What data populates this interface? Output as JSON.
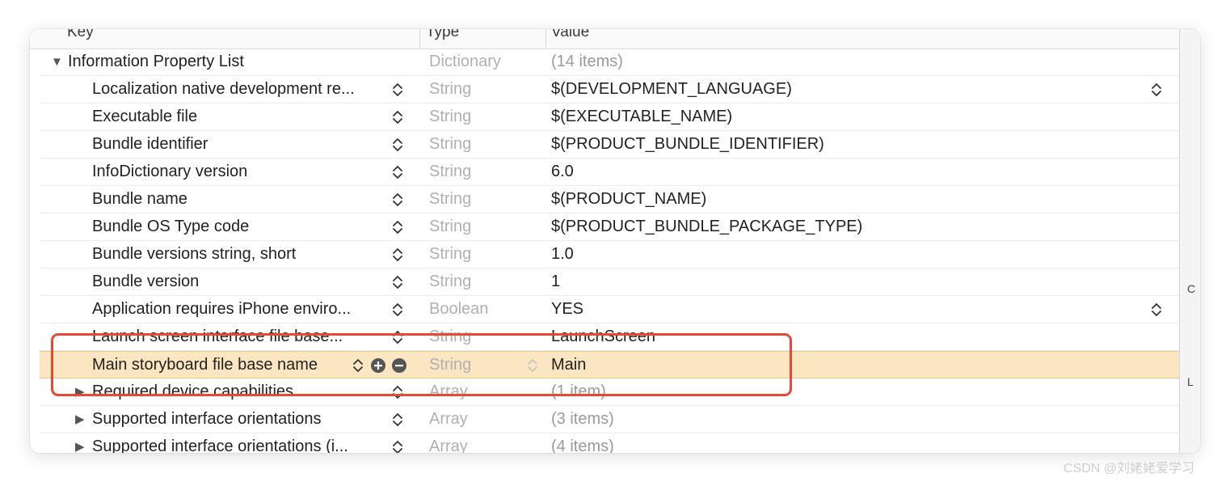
{
  "header": {
    "key": "Key",
    "type": "Type",
    "value": "Value"
  },
  "rows": [
    {
      "key": "Information Property List",
      "type": "Dictionary",
      "value": "(14 items)"
    },
    {
      "key": "Localization native development re...",
      "type": "String",
      "value": "$(DEVELOPMENT_LANGUAGE)"
    },
    {
      "key": "Executable file",
      "type": "String",
      "value": "$(EXECUTABLE_NAME)"
    },
    {
      "key": "Bundle identifier",
      "type": "String",
      "value": "$(PRODUCT_BUNDLE_IDENTIFIER)"
    },
    {
      "key": "InfoDictionary version",
      "type": "String",
      "value": "6.0"
    },
    {
      "key": "Bundle name",
      "type": "String",
      "value": "$(PRODUCT_NAME)"
    },
    {
      "key": "Bundle OS Type code",
      "type": "String",
      "value": "$(PRODUCT_BUNDLE_PACKAGE_TYPE)"
    },
    {
      "key": "Bundle versions string, short",
      "type": "String",
      "value": "1.0"
    },
    {
      "key": "Bundle version",
      "type": "String",
      "value": "1"
    },
    {
      "key": "Application requires iPhone enviro...",
      "type": "Boolean",
      "value": "YES"
    },
    {
      "key": "Launch screen interface file base...",
      "type": "String",
      "value": "LaunchScreen"
    },
    {
      "key": "Main storyboard file base name",
      "type": "String",
      "value": "Main"
    },
    {
      "key": "Required device capabilities",
      "type": "Array",
      "value": "(1 item)"
    },
    {
      "key": "Supported interface orientations",
      "type": "Array",
      "value": "(3 items)"
    },
    {
      "key": "Supported interface orientations (i...",
      "type": "Array",
      "value": "(4 items)"
    }
  ],
  "right_strip": {
    "label_c": "C",
    "label_l": "L"
  },
  "watermark": "CSDN @刘姥姥爱学习",
  "colors": {
    "selection": "#fbe6c1",
    "highlight_border": "#e44a35",
    "type_text": "#b0b0b0"
  },
  "icons": {
    "disclosure_open": "disclosure-open-icon",
    "disclosure_closed": "disclosure-closed-icon",
    "stepper": "stepper-icon",
    "add": "add-row-icon",
    "remove": "remove-row-icon"
  }
}
